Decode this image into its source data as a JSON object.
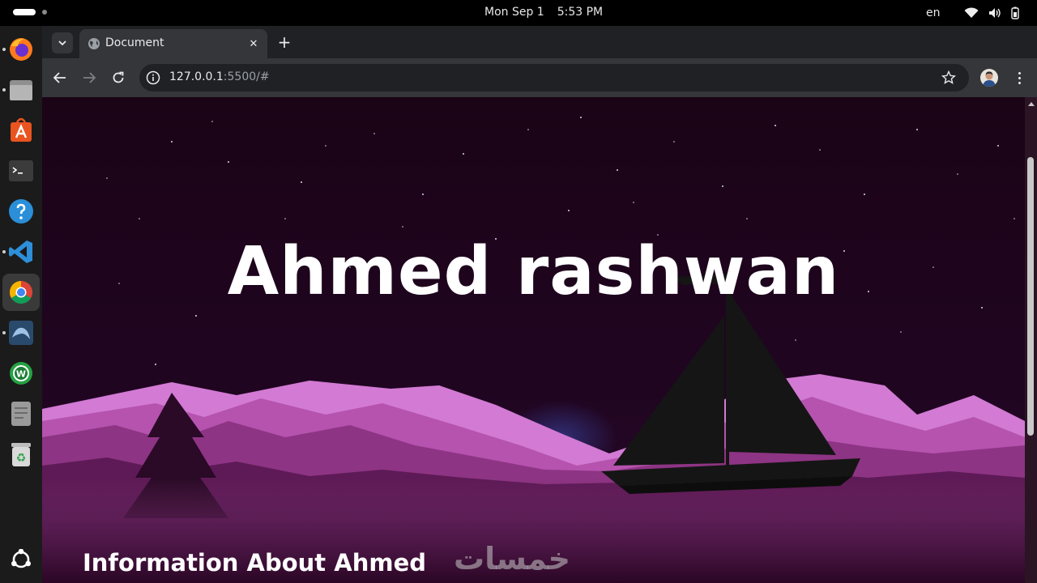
{
  "topbar": {
    "date": "Mon Sep 1",
    "time": "5:53 PM",
    "language": "en"
  },
  "dock": {
    "apps": [
      "firefox-icon",
      "files-icon",
      "app-center-icon",
      "terminal-icon",
      "help-icon",
      "vscode-icon",
      "chrome-icon",
      "mysql-workbench-icon",
      "whatsapp-icon",
      "text-editor-icon",
      "trash-icon"
    ],
    "show_apps": "ubuntu-logo-icon"
  },
  "browser": {
    "tab_title": "Document",
    "url_host": "127.0.0.1",
    "url_rest": ":5500/#"
  },
  "page": {
    "hero_title": "Ahmed rashwan",
    "section_title": "Information About Ahmed",
    "watermark": "خمسات"
  },
  "colors": {
    "sky": "#1c0417",
    "mountain_light": "#d27ad4",
    "mountain_mid": "#a5449e",
    "mountain_dark": "#4b1341",
    "boat": "#151515"
  }
}
